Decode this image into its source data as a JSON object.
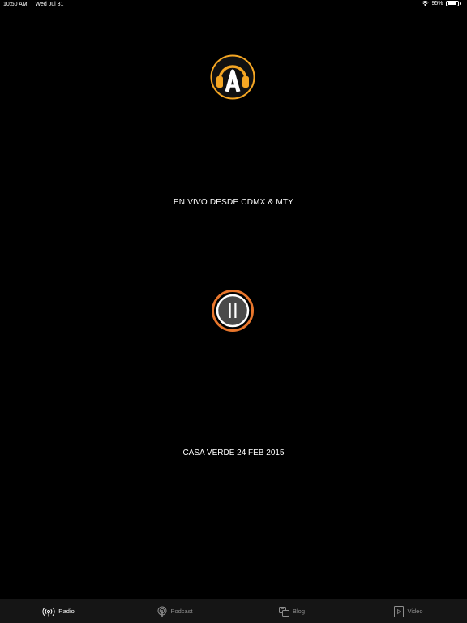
{
  "status_bar": {
    "time": "10:50 AM",
    "date": "Wed Jul 31",
    "battery": "95%",
    "battery_level": 0.95,
    "icons": [
      "wifi-icon",
      "battery-icon"
    ]
  },
  "logo": {
    "icon": "headphones-a-logo",
    "accent_color": "#F5A623"
  },
  "tagline": "EN VIVO DESDE CDMX & MTY",
  "player": {
    "icon": "pause-icon",
    "ring_color": "#E8762C",
    "state": "playing"
  },
  "now_playing": "CASA VERDE 24 FEB 2015",
  "tabs": [
    {
      "label": "Radio",
      "icon": "radio-broadcast-icon",
      "active": true
    },
    {
      "label": "Podcast",
      "icon": "podcast-icon",
      "active": false
    },
    {
      "label": "Blog",
      "icon": "blog-icon",
      "active": false
    },
    {
      "label": "Video",
      "icon": "video-icon",
      "active": false
    }
  ]
}
